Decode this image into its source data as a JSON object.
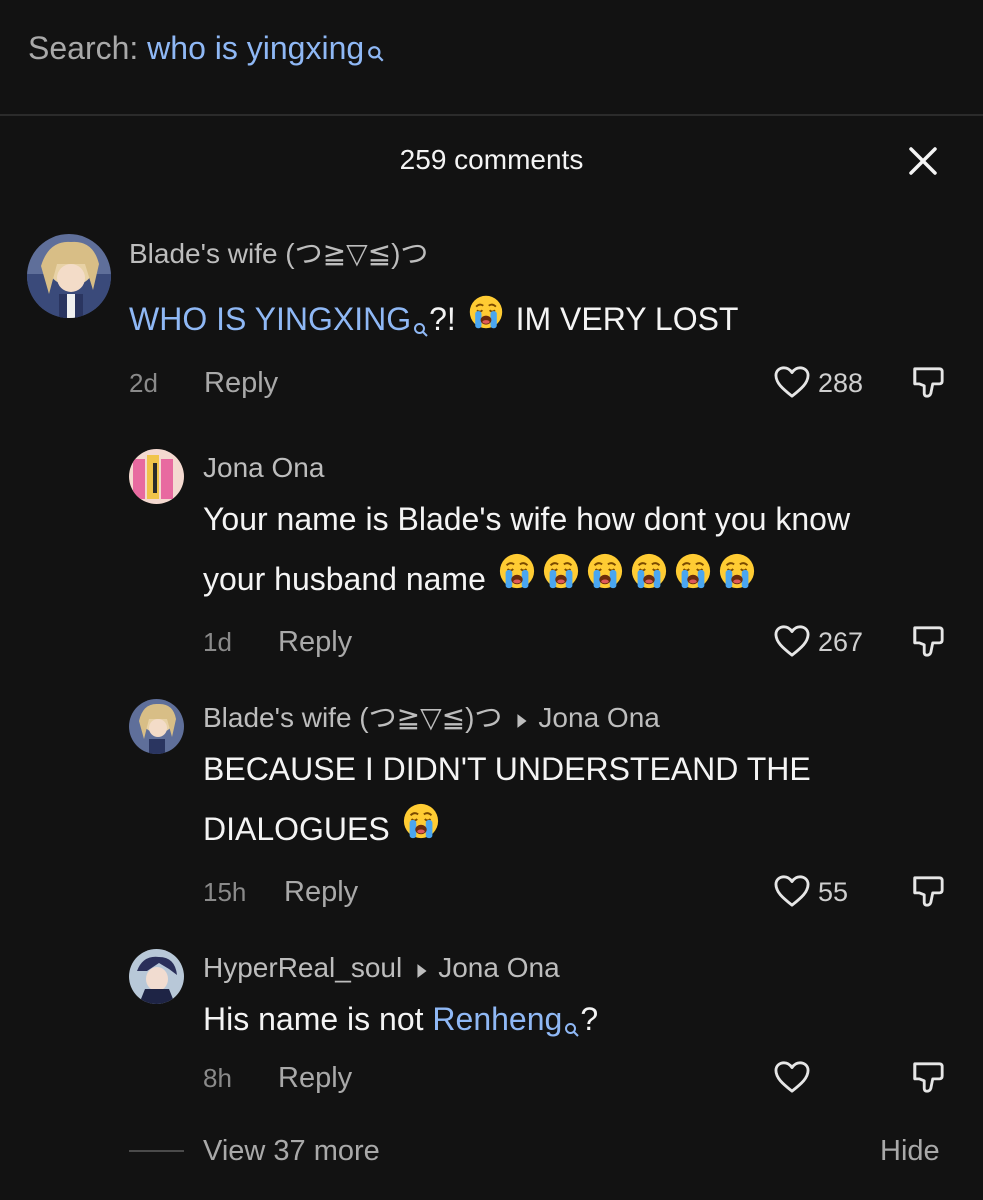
{
  "search": {
    "label": "Search:",
    "query": "who is yingxing"
  },
  "header": {
    "comments_count": "259 comments"
  },
  "comments": [
    {
      "username": "Blade's wife (つ≧▽≦)つ",
      "text_link": "WHO IS YINGXING",
      "text_rest": "?! ",
      "text_tail": "IM VERY LOST",
      "time": "2d",
      "reply_label": "Reply",
      "likes": "288"
    },
    {
      "username": "Jona Ona",
      "text_line1": "Your name is Blade's wife how dont you know",
      "text_line2": "your husband name",
      "time": "1d",
      "reply_label": "Reply",
      "likes": "267"
    },
    {
      "username": "Blade's wife (つ≧▽≦)つ",
      "reply_to": "Jona Ona",
      "text_line1": "BECAUSE I DIDN'T UNDERSTEAND THE",
      "text_line2": "DIALOGUES",
      "time": "15h",
      "reply_label": "Reply",
      "likes": "55"
    },
    {
      "username": "HyperReal_soul",
      "reply_to": "Jona Ona",
      "text_pre": "His name is not ",
      "text_link": "Renheng",
      "text_post": "?",
      "time": "8h",
      "reply_label": "Reply"
    }
  ],
  "footer": {
    "view_more": "View 37 more",
    "hide": "Hide"
  },
  "icons": {
    "search": "search-icon",
    "close": "close-icon",
    "like": "heart-icon",
    "dislike": "thumbs-down-icon",
    "emoji": "loudly-crying-face"
  },
  "colors": {
    "background": "#121212",
    "accent": "#8fb8f5"
  }
}
